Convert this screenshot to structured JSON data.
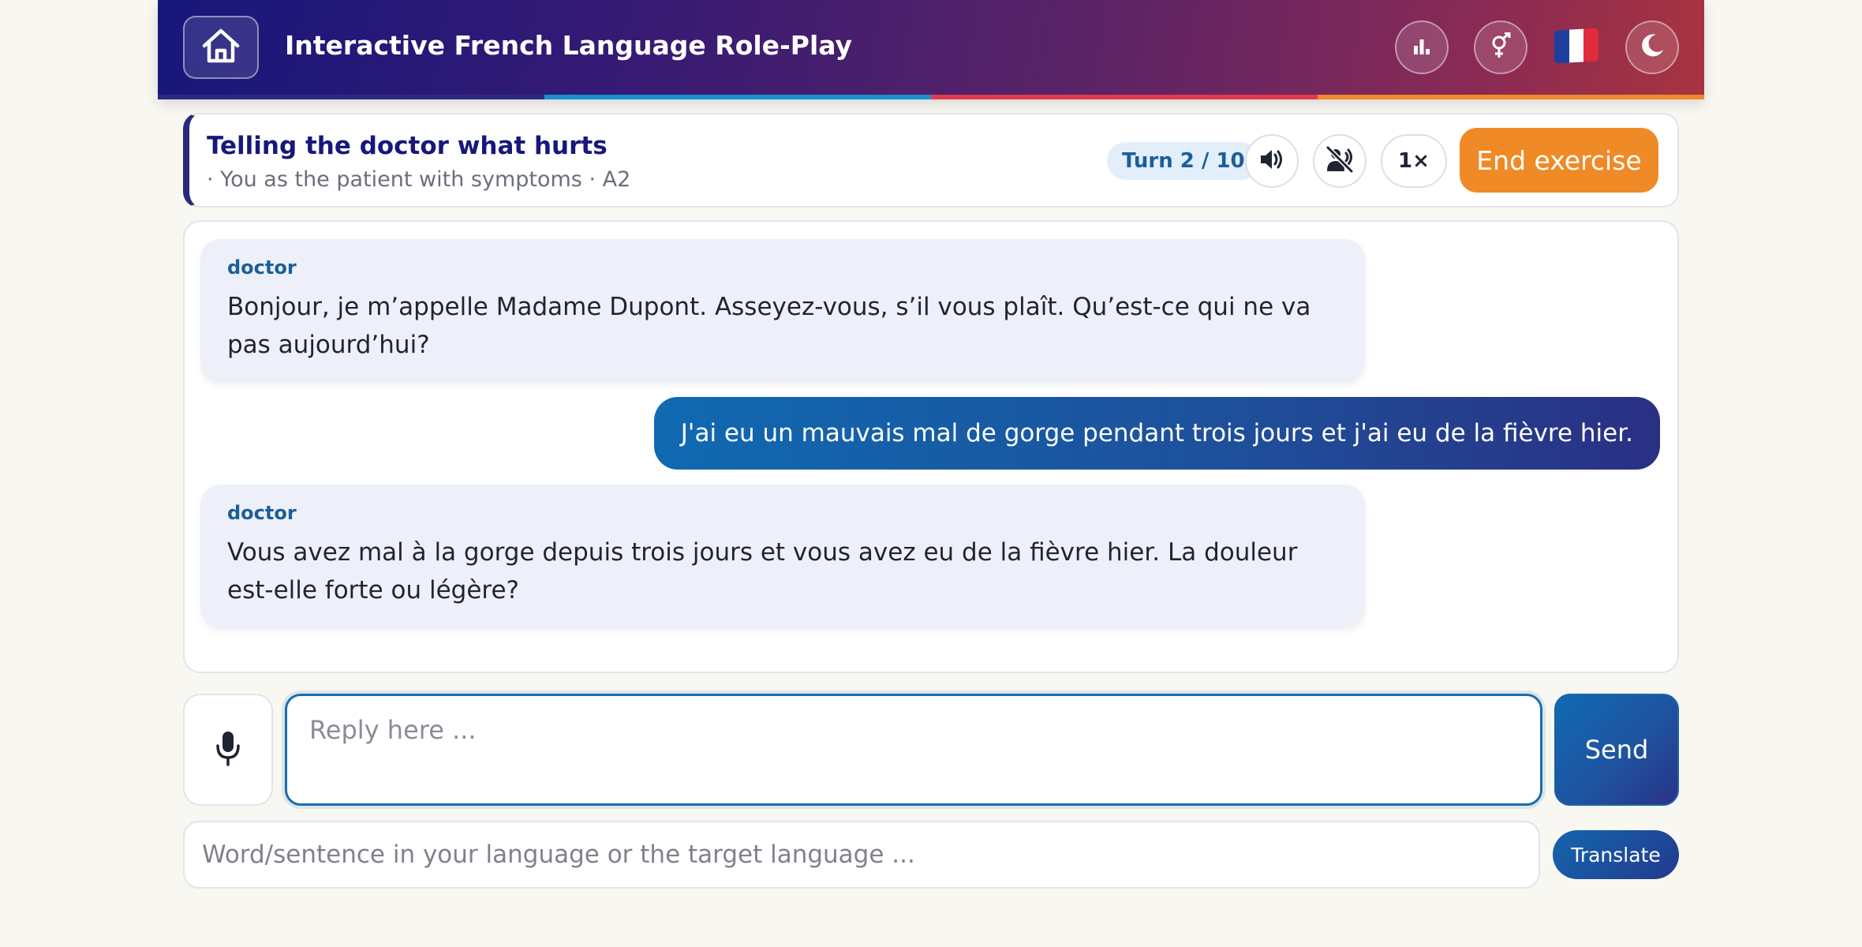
{
  "header": {
    "title": "Interactive French Language Role-Play",
    "stripe_colors": [
      "#2b2a80",
      "#1a8fd0",
      "#e23a4f",
      "#f08a26"
    ],
    "icons": [
      "home-icon",
      "chart-icon",
      "gender-icon",
      "french-flag-icon",
      "moon-icon"
    ],
    "flag_colors": [
      "#1f3fa0",
      "#ffffff",
      "#e12a3b"
    ]
  },
  "exercise": {
    "title": "Telling the doctor what hurts",
    "subtitle": "· You as the patient with symptoms · A2",
    "turn": "Turn 2 / 10",
    "speed": "1×",
    "end_label": "End exercise",
    "icons": [
      "speaker-icon",
      "auto-speak-off-icon"
    ]
  },
  "messages": [
    {
      "role": "doctor",
      "speaker": "doctor",
      "text": "Bonjour, je m’appelle Madame Dupont. Asseyez-vous, s’il vous plaît. Qu’est-ce qui ne va pas aujourd’hui?"
    },
    {
      "role": "user",
      "text": "J'ai eu un mauvais mal de gorge pendant trois jours et j'ai eu de la fièvre hier."
    },
    {
      "role": "doctor",
      "speaker": "doctor",
      "text": "Vous avez mal à la gorge depuis trois jours et vous avez eu de la fièvre hier. La douleur est-elle forte ou légère?"
    }
  ],
  "composer": {
    "placeholder": "Reply here ...",
    "send_label": "Send",
    "mic_icon": "microphone-icon"
  },
  "translator": {
    "placeholder": "Word/sentence in your language or the target language ...",
    "button_label": "Translate"
  },
  "colors": {
    "accent_orange": "#f08a26",
    "accent_blue": "#1b5f98",
    "navy": "#17187a"
  }
}
